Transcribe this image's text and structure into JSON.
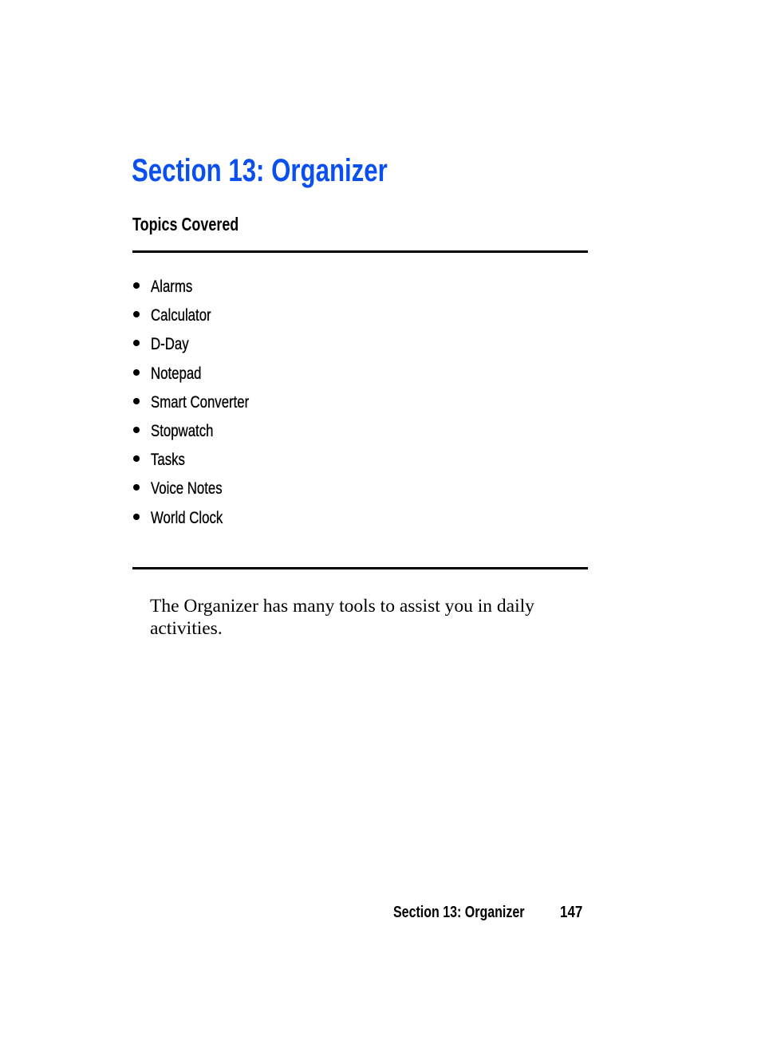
{
  "page": {
    "title": "Section 13: Organizer",
    "title_color": "#0a4ff0",
    "topics_heading": "Topics Covered",
    "topics": [
      "Alarms",
      "Calculator",
      "D-Day",
      "Notepad",
      "Smart Converter",
      "Stopwatch",
      "Tasks",
      "Voice Notes",
      "World Clock"
    ],
    "body": "The Organizer has many tools to assist you in daily activities."
  },
  "footer": {
    "section": "Section 13: Organizer",
    "page_number": "147"
  }
}
